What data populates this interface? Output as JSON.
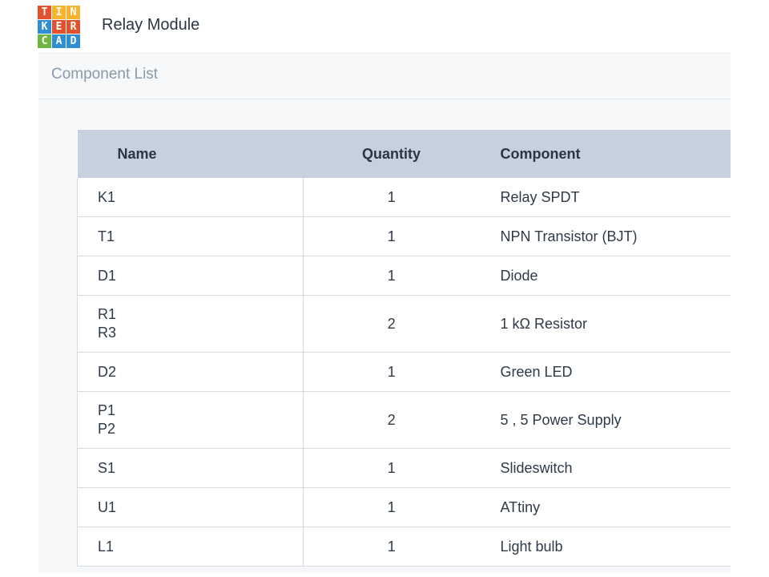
{
  "app": {
    "logo": {
      "icon": "tinkercad-logo",
      "letters": [
        "T",
        "I",
        "N",
        "K",
        "E",
        "R",
        "C",
        "A",
        "D"
      ],
      "colors": [
        "#e2532d",
        "#f7b32e",
        "#f7b32e",
        "#2f8dd1",
        "#e2532d",
        "#e2532d",
        "#6fb53f",
        "#2f8dd1",
        "#2f8dd1"
      ]
    },
    "title": "Relay Module"
  },
  "section": {
    "title": "Component List"
  },
  "table": {
    "headers": {
      "name": "Name",
      "quantity": "Quantity",
      "component": "Component"
    },
    "rows": [
      {
        "names": [
          "K1"
        ],
        "quantity": "1",
        "component": "Relay SPDT"
      },
      {
        "names": [
          "T1"
        ],
        "quantity": "1",
        "component": "NPN Transistor (BJT)"
      },
      {
        "names": [
          "D1"
        ],
        "quantity": "1",
        "component": "Diode"
      },
      {
        "names": [
          "R1",
          "R3"
        ],
        "quantity": "2",
        "component": "1 kΩ Resistor"
      },
      {
        "names": [
          "D2"
        ],
        "quantity": "1",
        "component": "Green LED"
      },
      {
        "names": [
          "P1",
          "P2"
        ],
        "quantity": "2",
        "component": "5 , 5 Power Supply"
      },
      {
        "names": [
          "S1"
        ],
        "quantity": "1",
        "component": "Slideswitch"
      },
      {
        "names": [
          "U1"
        ],
        "quantity": "1",
        "component": "ATtiny"
      },
      {
        "names": [
          "L1"
        ],
        "quantity": "1",
        "component": "Light bulb"
      }
    ]
  }
}
